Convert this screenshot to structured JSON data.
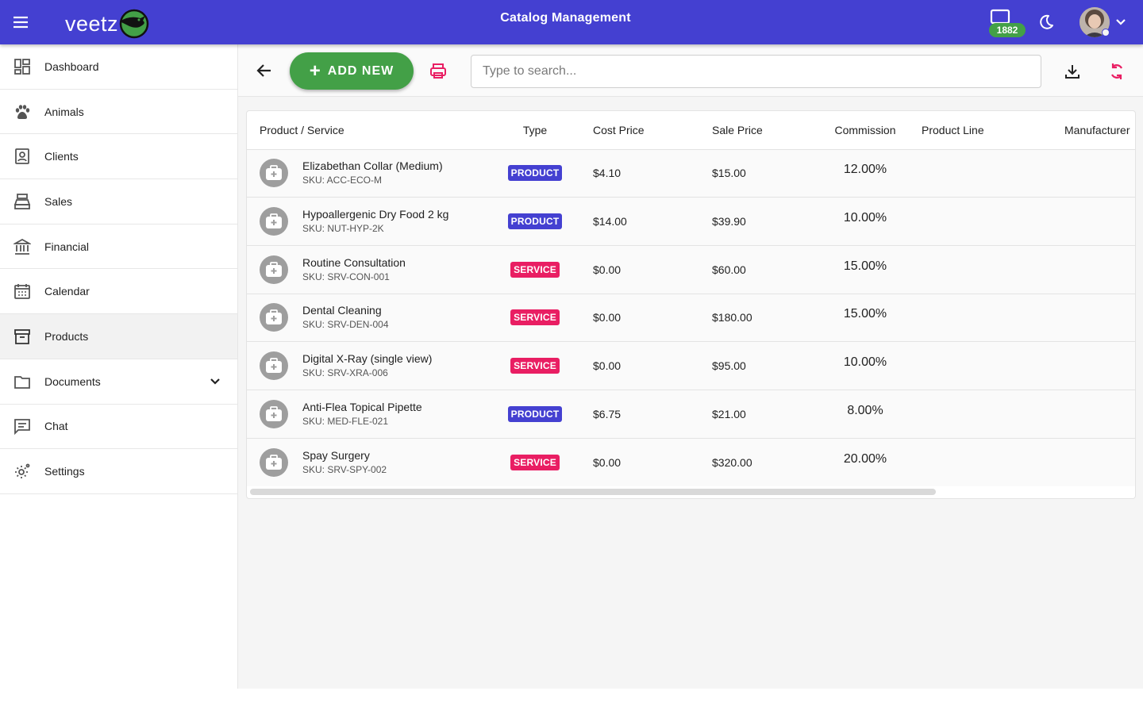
{
  "header": {
    "logo_text": "veetz",
    "title": "Catalog Management",
    "notification_count": "1882",
    "colors": {
      "primary": "#4440d1",
      "success": "#43a047",
      "accent": "#e91e63"
    }
  },
  "sidebar": {
    "items": [
      {
        "label": "Dashboard",
        "icon": "dashboard-icon"
      },
      {
        "label": "Animals",
        "icon": "paw-icon"
      },
      {
        "label": "Clients",
        "icon": "contact-card-icon"
      },
      {
        "label": "Sales",
        "icon": "cash-register-icon"
      },
      {
        "label": "Financial",
        "icon": "bank-icon"
      },
      {
        "label": "Calendar",
        "icon": "calendar-icon"
      },
      {
        "label": "Products",
        "icon": "archive-box-icon",
        "active": true
      },
      {
        "label": "Documents",
        "icon": "folder-icon",
        "expandable": true
      },
      {
        "label": "Chat",
        "icon": "chat-icon"
      },
      {
        "label": "Settings",
        "icon": "gear-icon"
      }
    ]
  },
  "toolbar": {
    "add_label": "ADD NEW",
    "search_placeholder": "Type to search...",
    "search_value": ""
  },
  "table": {
    "columns": [
      "Product / Service",
      "Type",
      "Cost Price",
      "Sale Price",
      "Commission",
      "Product Line",
      "Manufacturer"
    ],
    "rows": [
      {
        "name": "Elizabethan Collar (Medium)",
        "sku": "SKU: ACC-ECO-M",
        "type": "PRODUCT",
        "cost": "$4.10",
        "sale": "$15.00",
        "commission": "12.00%",
        "line": "",
        "manufacturer": ""
      },
      {
        "name": "Hypoallergenic Dry Food 2 kg",
        "sku": "SKU: NUT-HYP-2K",
        "type": "PRODUCT",
        "cost": "$14.00",
        "sale": "$39.90",
        "commission": "10.00%",
        "line": "",
        "manufacturer": ""
      },
      {
        "name": "Routine Consultation",
        "sku": "SKU: SRV-CON-001",
        "type": "SERVICE",
        "cost": "$0.00",
        "sale": "$60.00",
        "commission": "15.00%",
        "line": "",
        "manufacturer": ""
      },
      {
        "name": "Dental Cleaning",
        "sku": "SKU: SRV-DEN-004",
        "type": "SERVICE",
        "cost": "$0.00",
        "sale": "$180.00",
        "commission": "15.00%",
        "line": "",
        "manufacturer": ""
      },
      {
        "name": "Digital X-Ray (single view)",
        "sku": "SKU: SRV-XRA-006",
        "type": "SERVICE",
        "cost": "$0.00",
        "sale": "$95.00",
        "commission": "10.00%",
        "line": "",
        "manufacturer": ""
      },
      {
        "name": "Anti-Flea Topical Pipette",
        "sku": "SKU: MED-FLE-021",
        "type": "PRODUCT",
        "cost": "$6.75",
        "sale": "$21.00",
        "commission": "8.00%",
        "line": "",
        "manufacturer": ""
      },
      {
        "name": "Spay Surgery",
        "sku": "SKU: SRV-SPY-002",
        "type": "SERVICE",
        "cost": "$0.00",
        "sale": "$320.00",
        "commission": "20.00%",
        "line": "",
        "manufacturer": ""
      }
    ]
  }
}
